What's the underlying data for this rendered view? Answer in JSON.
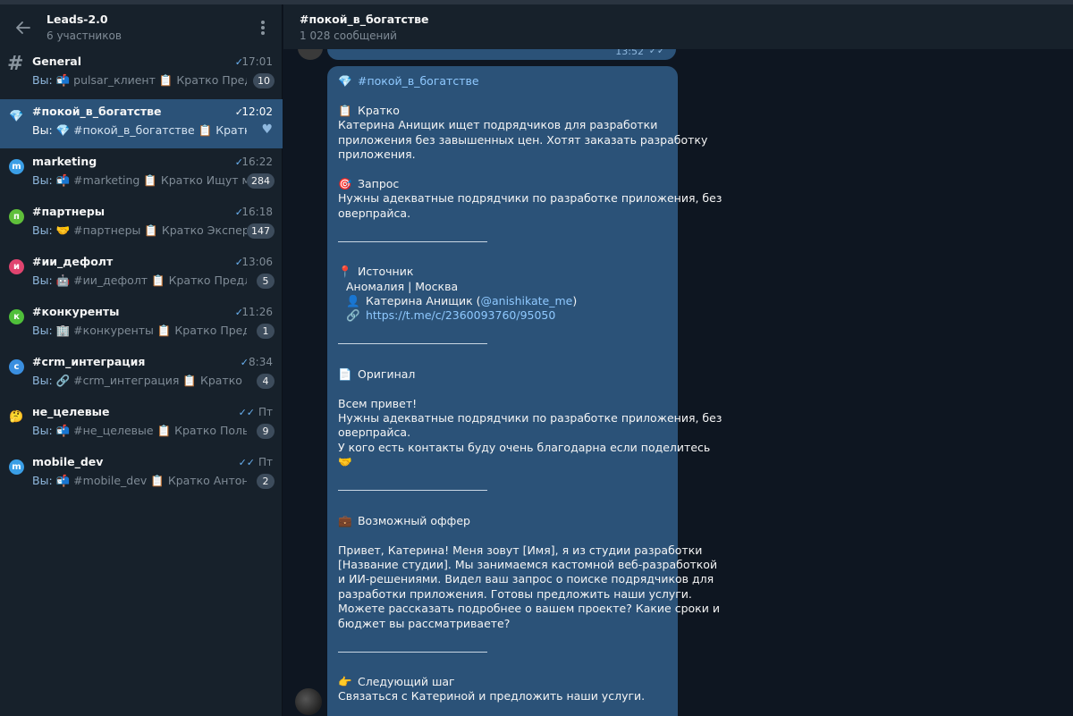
{
  "sidebar": {
    "title": "Leads-2.0",
    "subtitle": "6 участников",
    "chats": [
      {
        "name": "General",
        "time": "17:01",
        "check": "✓",
        "icon": "hash-icon",
        "you": "Вы:",
        "preview": "📬 pulsar_клиент 📋 Кратко Пред…",
        "badge": "10"
      },
      {
        "name": "#покой_в_богатстве",
        "time": "12:02",
        "check": "✓",
        "icon": "diamond-icon",
        "you": "Вы:",
        "preview": "💎 #покой_в_богатстве 📋 Кратко …",
        "badge": "",
        "heart": "♥"
      },
      {
        "name": "marketing",
        "time": "16:22",
        "check": "✓",
        "icon": "letter-m-avatar",
        "avatar_letter": "m",
        "avatar_color": "#3a9ee6",
        "you": "Вы:",
        "preview": "📬 #marketing 📋 Кратко Ищут м…",
        "badge": "284"
      },
      {
        "name": "#партнеры",
        "time": "16:18",
        "check": "✓",
        "icon": "letter-p-avatar",
        "avatar_letter": "п",
        "avatar_color": "#5fbf3a",
        "you": "Вы:",
        "preview": "🤝 #партнеры 📋 Кратко Экспер…",
        "badge": "147"
      },
      {
        "name": "#ии_дефолт",
        "time": "13:06",
        "check": "✓",
        "icon": "letter-i-avatar",
        "avatar_letter": "и",
        "avatar_color": "#e0446f",
        "you": "Вы:",
        "preview": "🤖 #ии_дефолт 📋 Кратко Предло…",
        "badge": "5"
      },
      {
        "name": "#конкуренты",
        "time": "11:26",
        "check": "✓",
        "icon": "letter-k-avatar",
        "avatar_letter": "к",
        "avatar_color": "#4fbf3a",
        "you": "Вы:",
        "preview": "🏢 #конкуренты 📋 Кратко Предл…",
        "badge": "1"
      },
      {
        "name": "#crm_интеграция",
        "time": "8:34",
        "check": "✓",
        "icon": "letter-c-avatar",
        "avatar_letter": "c",
        "avatar_color": "#3a8fe0",
        "you": "Вы:",
        "preview": "🔗 #crm_интеграция 📋 Кратко По…",
        "badge": "4"
      },
      {
        "name": "не_целевые",
        "time": "Пт",
        "check": "✓✓",
        "icon": "thinking-emoji-icon",
        "avatar_emoji": "🤔",
        "you": "Вы:",
        "preview": "📬 #не_целевые 📋 Кратко Польз…",
        "badge": "9"
      },
      {
        "name": "mobile_dev",
        "time": "Пт",
        "check": "✓✓",
        "icon": "letter-m2-avatar",
        "avatar_letter": "m",
        "avatar_color": "#3a9ee6",
        "you": "Вы:",
        "preview": "📬 #mobile_dev 📋 Кратко Антон К…",
        "badge": "2"
      }
    ]
  },
  "header": {
    "title": "#покой_в_богатстве",
    "subtitle": "1 028 сообщений"
  },
  "prev_message": {
    "time": "13:52",
    "checks": "✓✓"
  },
  "message": {
    "tag": "#покой_в_богатстве",
    "tag_emoji": "💎",
    "kratko_emoji": "📋",
    "kratko_title": "Кратко",
    "kratko_1": "Катерина Анищик ищет подрядчиков для разработки",
    "kratko_2": "приложения без завышенных цен. Хотят заказать разработку",
    "kratko_3": "приложения.",
    "zapros_emoji": "🎯",
    "zapros_title": "Запрос",
    "zapros_1": "Нужны адекватные подрядчики по разработке приложения, без",
    "zapros_2": "оверпрайса.",
    "source_emoji": "📍",
    "source_title": "Источник",
    "source_place": "Аномалия | Москва",
    "source_person_emoji": "👤",
    "source_person": "Катерина Анищик (",
    "source_handle": "@anishikate_me",
    "source_person_end": ")",
    "source_link_emoji": "🔗",
    "source_link": "https://t.me/c/2360093760/95050",
    "orig_emoji": "📄",
    "orig_title": "Оригинал",
    "orig_1": "Всем привет!",
    "orig_2": "Нужны адекватные подрядчики по разработке приложения, без",
    "orig_3": "оверпрайса.",
    "orig_4": "У кого есть контакты буду очень благодарна если поделитесь",
    "orig_5": "🤝",
    "offer_emoji": "💼",
    "offer_title": "Возможный оффер",
    "offer_1": "Привет, Катерина! Меня зовут [Имя], я из студии разработки",
    "offer_2": "[Название студии]. Мы занимаемся кастомной веб-разработкой",
    "offer_3": "и ИИ-решениями. Видел ваш запрос о поиске подрядчиков для",
    "offer_4": "разработки приложения. Готовы предложить наши услуги.",
    "offer_5": "Можете рассказать подробнее о вашем проекте? Какие сроки и",
    "offer_6": "бюджет вы рассматриваете?",
    "next_emoji": "👉",
    "next_title": "Следующий шаг",
    "next_1": "Связаться с Катериной и предложить наши услуги."
  },
  "colors": {
    "bg": "#0e1621",
    "panel": "#17212b",
    "bubble": "#2b5278",
    "accent": "#6ab2f2"
  }
}
